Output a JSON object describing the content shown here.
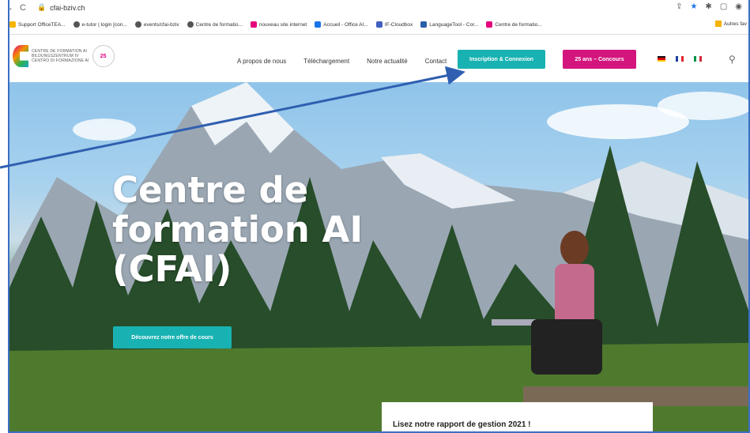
{
  "browser": {
    "url": "cfai-bziv.ch",
    "bookmarks": [
      "Support OfficeTEA...",
      "e-tutor | login [con...",
      "events/cfai-bziv",
      "Centre de formatio...",
      "nouveau site internet",
      "Accueil - Office AI...",
      "IF-Cloudbox",
      "LanguageTool - Cor...",
      "Centre de formatio..."
    ],
    "other_bookmarks": "Autres fav"
  },
  "site": {
    "logo_text": [
      "CENTRE DE FORMATION AI",
      "BILDUNGSZENTRUM IV",
      "CENTRO DI FORMAZIONE AI"
    ],
    "logo_badge": "25",
    "menu": [
      "A propos de nous",
      "Téléchargement",
      "Notre actualité",
      "Contact"
    ],
    "login_button": "Inscription & Connexion",
    "contest_button": "25 ans – Concours",
    "flags": [
      "de",
      "fr",
      "it"
    ]
  },
  "hero": {
    "title_lines": [
      "Centre de",
      "formation AI",
      "(CFAI)"
    ],
    "cta": "Découvrez notre offre de cours",
    "card_text": "Lisez notre rapport de gestion 2021 !"
  },
  "colors": {
    "teal": "#19b2b2",
    "pink": "#d4157e",
    "arrow": "#2f5fb0"
  }
}
